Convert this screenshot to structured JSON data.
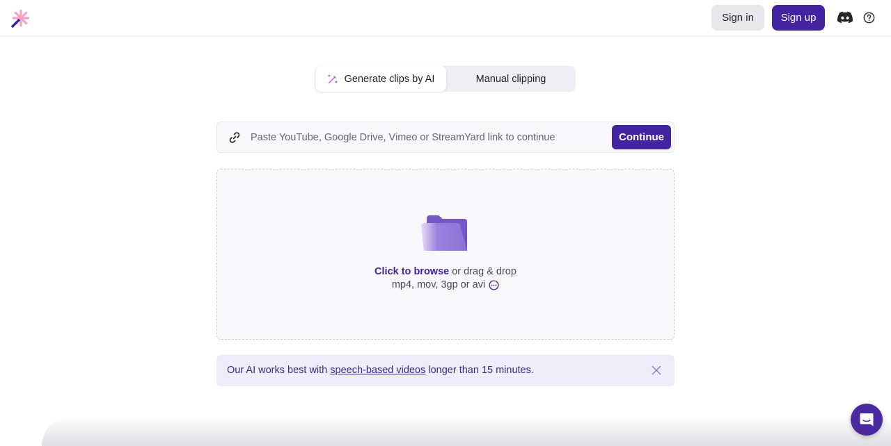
{
  "header": {
    "logo": "sparkle-wand-logo",
    "sign_in_label": "Sign in",
    "sign_up_label": "Sign up",
    "icons": [
      "discord-icon",
      "help-icon"
    ]
  },
  "mode_toggle": {
    "tabs": [
      {
        "label": "Generate clips by AI",
        "icon": "magic-wand-icon",
        "active": true
      },
      {
        "label": "Manual clipping",
        "active": false
      }
    ]
  },
  "url_bar": {
    "icon": "link-icon",
    "value": "",
    "placeholder": "Paste YouTube, Google Drive, Vimeo or StreamYard link to continue",
    "continue_label": "Continue"
  },
  "dropzone": {
    "icon": "folder-icon",
    "browse_label": "Click to browse",
    "drag_text": " or drag & drop",
    "formats": "mp4, mov, 3gp or avi",
    "more_icon": "more-formats-icon"
  },
  "notice": {
    "prefix": "Our AI works best with ",
    "link_label": "speech-based videos",
    "suffix": " longer than 15 minutes."
  },
  "colors": {
    "primary": "#4324a0",
    "notice_bg": "#efedfa",
    "logo_pink": "#f28ab8"
  }
}
